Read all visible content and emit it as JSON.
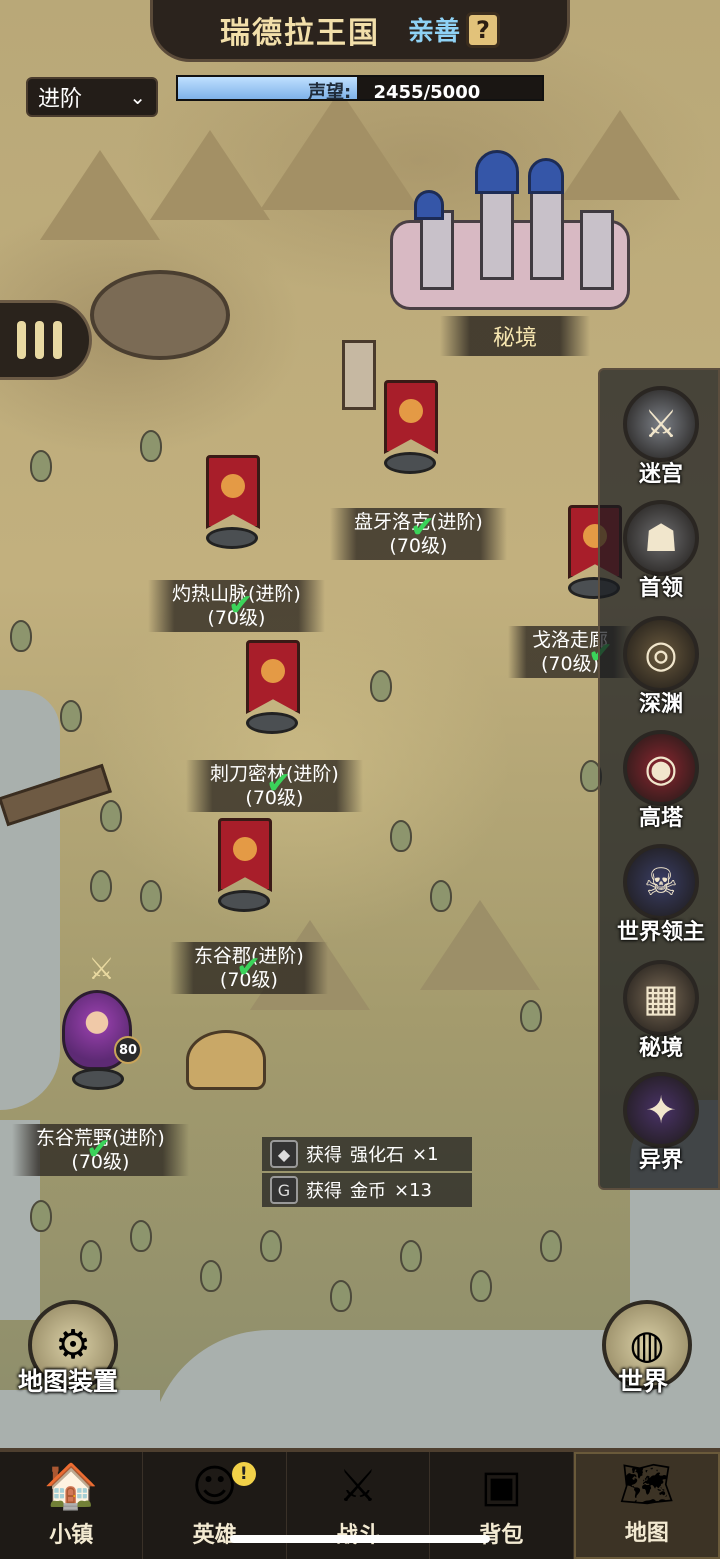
{
  "header": {
    "kingdom_title": "瑞德拉王国",
    "relation": "亲善",
    "help_glyph": "?"
  },
  "mode_select": {
    "value": "进阶",
    "arrow": "⌄"
  },
  "reputation": {
    "label": "声望:",
    "value_text": "2455/5000",
    "current": 2455,
    "max": 5000
  },
  "map_nodes": [
    {
      "name": "盘牙洛克(进阶)",
      "level": "(70级)",
      "cleared": true
    },
    {
      "name": "灼热山脉(进阶)",
      "level": "(70级)",
      "cleared": true
    },
    {
      "name": "戈洛走廊",
      "level": "(70级)",
      "cleared": true
    },
    {
      "name": "刺刀密林(进阶)",
      "level": "(70级)",
      "cleared": true
    },
    {
      "name": "东谷郡(进阶)",
      "level": "(70级)",
      "cleared": true
    },
    {
      "name": "东谷荒野(进阶)",
      "level": "(70级)",
      "cleared": true
    }
  ],
  "secret_realm_label": "秘境",
  "hero": {
    "level": "80"
  },
  "side_menu": [
    {
      "label": "迷宫",
      "icon": "crossed-swords-icon",
      "glyph": "⚔",
      "color": "#7b7f86"
    },
    {
      "label": "首领",
      "icon": "horned-helmet-icon",
      "glyph": "☗",
      "color": "#6e6e70"
    },
    {
      "label": "深渊",
      "icon": "abyss-shield-icon",
      "glyph": "◎",
      "color": "#6a5a3e"
    },
    {
      "label": "高塔",
      "icon": "tower-eye-icon",
      "glyph": "◉",
      "color": "#8d2630"
    },
    {
      "label": "世界领主",
      "icon": "dragon-icon",
      "glyph": "☠",
      "color": "#3a3e66"
    },
    {
      "label": "秘境",
      "icon": "arena-icon",
      "glyph": "▦",
      "color": "#7a6a56"
    },
    {
      "label": "异界",
      "icon": "portal-icon",
      "glyph": "✦",
      "color": "#4a3368"
    }
  ],
  "rewards": [
    {
      "prefix": "获得",
      "item": "强化石",
      "count": "×1",
      "icon": "whetstone-icon",
      "glyph": "◆"
    },
    {
      "prefix": "获得",
      "item": "金币",
      "count": "×13",
      "icon": "gold-coin-icon",
      "glyph": "G"
    }
  ],
  "corner_buttons": {
    "map_equipment": "地图装置",
    "world": "世界"
  },
  "bottom_nav": [
    {
      "label": "小镇",
      "icon": "town-icon",
      "glyph": "🏠",
      "active": false
    },
    {
      "label": "英雄",
      "icon": "hero-icon",
      "glyph": "☺",
      "active": false,
      "badge": "!"
    },
    {
      "label": "战斗",
      "icon": "battle-icon",
      "glyph": "⚔",
      "active": false
    },
    {
      "label": "背包",
      "icon": "backpack-icon",
      "glyph": "▣",
      "active": false
    },
    {
      "label": "地图",
      "icon": "map-icon",
      "glyph": "🗺",
      "active": true
    }
  ]
}
